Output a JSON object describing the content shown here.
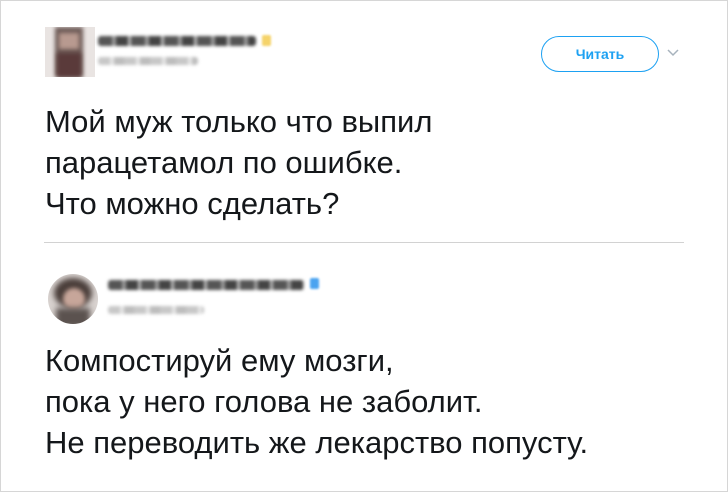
{
  "tweet1": {
    "follow_label": "Читать",
    "text": "Мой муж только что выпил\nпарацетамол по ошибке.\nЧто можно сделать?"
  },
  "tweet2": {
    "text": "Компостируй ему мозги,\nпока у него голова не заболит.\nНе переводить же лекарство попусту."
  },
  "colors": {
    "accent": "#1da1f2",
    "verified_badge_1": "#f5d36a",
    "verified_badge_2": "#4aa3f0"
  }
}
